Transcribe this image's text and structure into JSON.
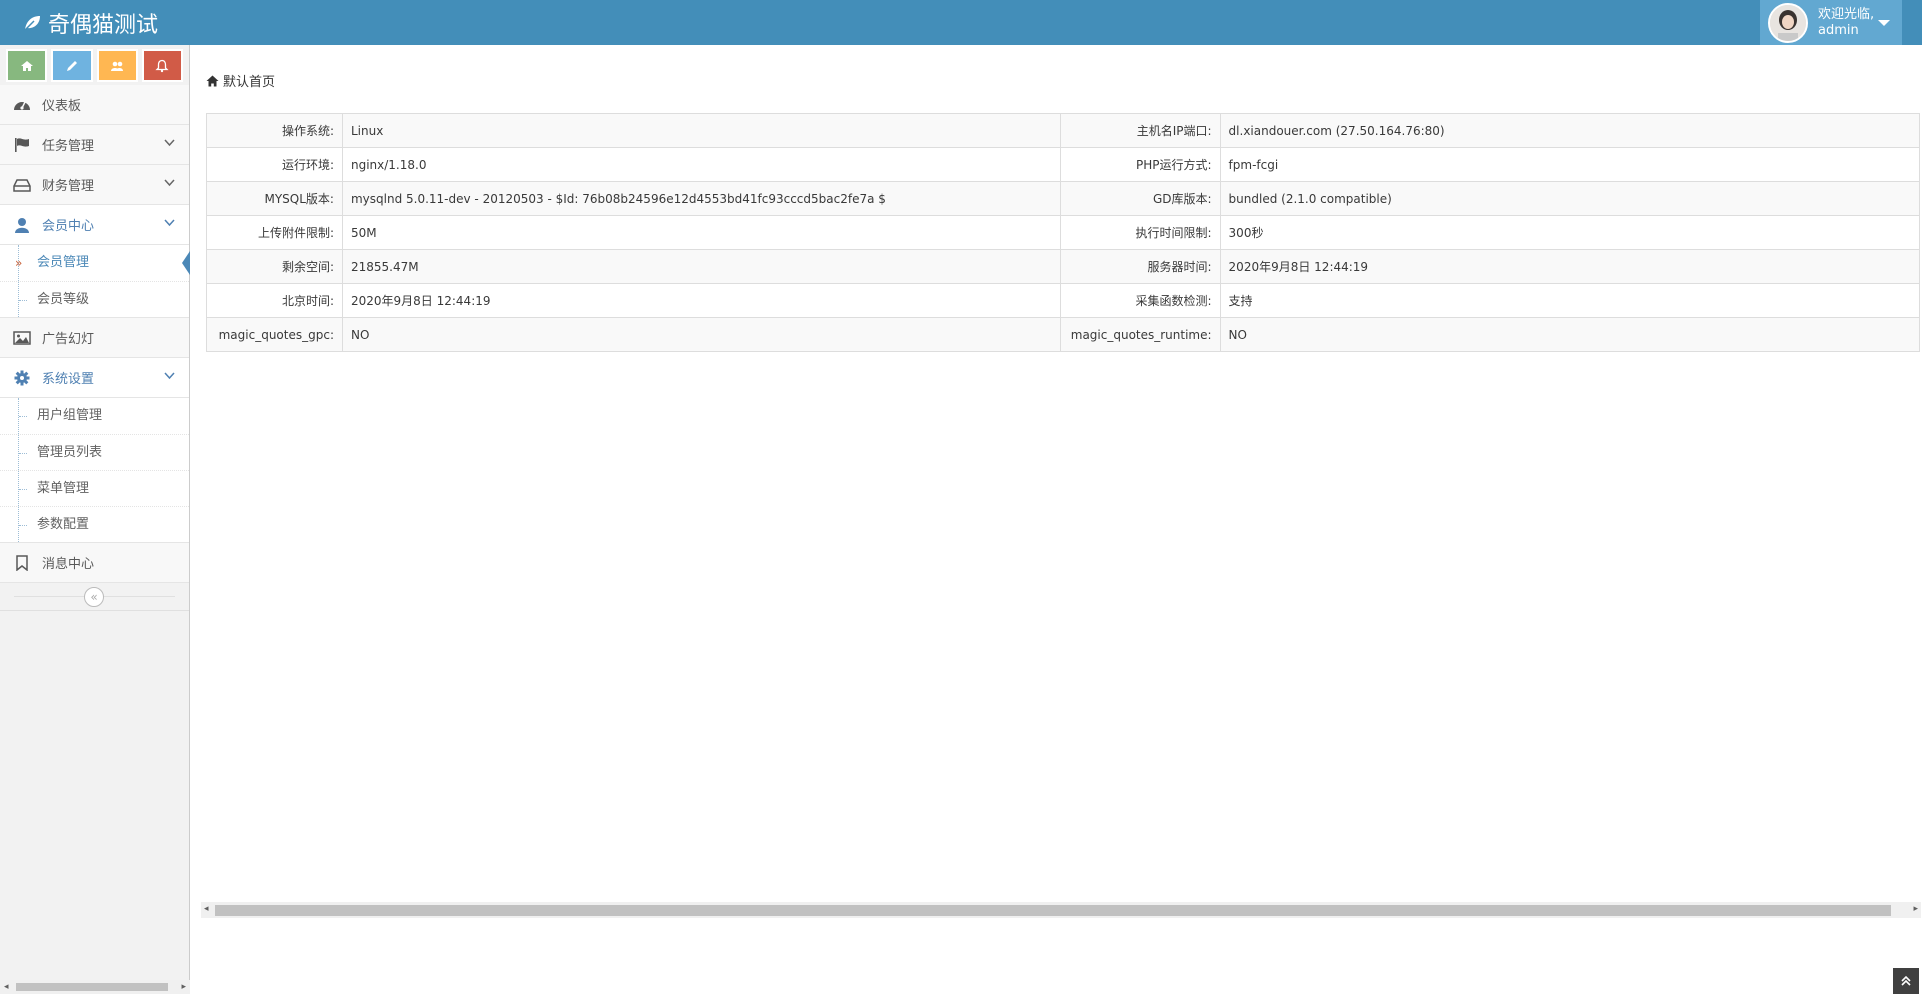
{
  "brand": {
    "title": "奇偶猫测试"
  },
  "user": {
    "welcome": "欢迎光临,",
    "name": "admin"
  },
  "shortcuts": [
    {
      "icon": "home-icon",
      "color": "#87b87f"
    },
    {
      "icon": "pencil-icon",
      "color": "#6fb3e0"
    },
    {
      "icon": "users-icon",
      "color": "#ffb752"
    },
    {
      "icon": "bell-icon",
      "color": "#d15b47"
    }
  ],
  "sidebar": {
    "dashboard": "仪表板",
    "tasks": "任务管理",
    "finance": "财务管理",
    "members": "会员中心",
    "member_items": [
      "会员管理",
      "会员等级"
    ],
    "ads": "广告幻灯",
    "system": "系统设置",
    "system_items": [
      "用户组管理",
      "管理员列表",
      "菜单管理",
      "参数配置"
    ],
    "messages": "消息中心"
  },
  "colors": {
    "navbar": "#438eb9",
    "accent": "#4b88b7"
  },
  "breadcrumb": {
    "label": "默认首页"
  },
  "info_rows": [
    {
      "l1": "操作系统:",
      "v1": "Linux",
      "l2": "主机名IP端口:",
      "v2": "dl.xiandouer.com (27.50.164.76:80)"
    },
    {
      "l1": "运行环境:",
      "v1": "nginx/1.18.0",
      "l2": "PHP运行方式:",
      "v2": "fpm-fcgi"
    },
    {
      "l1": "MYSQL版本:",
      "v1": "mysqlnd 5.0.11-dev - 20120503 - $Id: 76b08b24596e12d4553bd41fc93cccd5bac2fe7a $",
      "l2": "GD库版本:",
      "v2": "bundled (2.1.0 compatible)"
    },
    {
      "l1": "上传附件限制:",
      "v1": "50M",
      "l2": "执行时间限制:",
      "v2": "300秒"
    },
    {
      "l1": "剩余空间:",
      "v1": "21855.47M",
      "l2": "服务器时间:",
      "v2": "2020年9月8日 12:44:19"
    },
    {
      "l1": "北京时间:",
      "v1": "2020年9月8日 12:44:19",
      "l2": "采集函数检测:",
      "v2": "支持"
    },
    {
      "l1": "magic_quotes_gpc:",
      "v1": "NO",
      "l2": "magic_quotes_runtime:",
      "v2": "NO"
    }
  ]
}
